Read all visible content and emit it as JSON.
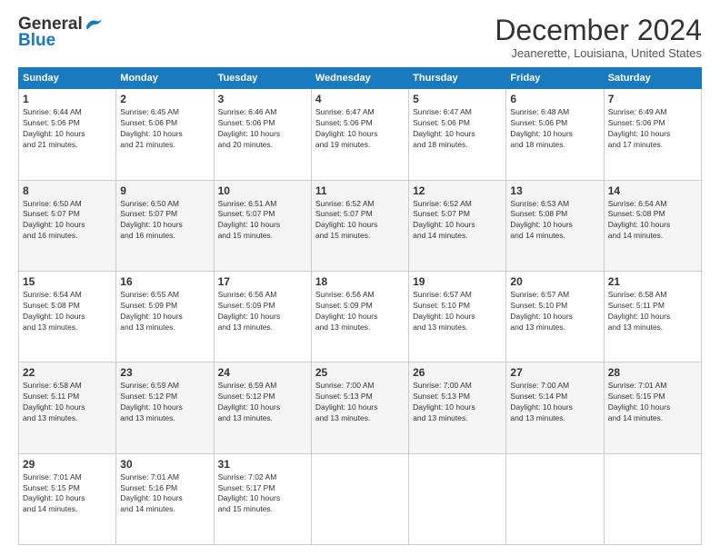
{
  "logo": {
    "general": "General",
    "blue": "Blue"
  },
  "title": "December 2024",
  "location": "Jeanerette, Louisiana, United States",
  "days_of_week": [
    "Sunday",
    "Monday",
    "Tuesday",
    "Wednesday",
    "Thursday",
    "Friday",
    "Saturday"
  ],
  "weeks": [
    [
      {
        "day": "1",
        "sunrise": "6:44 AM",
        "sunset": "5:06 PM",
        "daylight": "10 hours and 21 minutes."
      },
      {
        "day": "2",
        "sunrise": "6:45 AM",
        "sunset": "5:06 PM",
        "daylight": "10 hours and 21 minutes."
      },
      {
        "day": "3",
        "sunrise": "6:46 AM",
        "sunset": "5:06 PM",
        "daylight": "10 hours and 20 minutes."
      },
      {
        "day": "4",
        "sunrise": "6:47 AM",
        "sunset": "5:06 PM",
        "daylight": "10 hours and 19 minutes."
      },
      {
        "day": "5",
        "sunrise": "6:47 AM",
        "sunset": "5:06 PM",
        "daylight": "10 hours and 18 minutes."
      },
      {
        "day": "6",
        "sunrise": "6:48 AM",
        "sunset": "5:06 PM",
        "daylight": "10 hours and 18 minutes."
      },
      {
        "day": "7",
        "sunrise": "6:49 AM",
        "sunset": "5:06 PM",
        "daylight": "10 hours and 17 minutes."
      }
    ],
    [
      {
        "day": "8",
        "sunrise": "6:50 AM",
        "sunset": "5:07 PM",
        "daylight": "10 hours and 16 minutes."
      },
      {
        "day": "9",
        "sunrise": "6:50 AM",
        "sunset": "5:07 PM",
        "daylight": "10 hours and 16 minutes."
      },
      {
        "day": "10",
        "sunrise": "6:51 AM",
        "sunset": "5:07 PM",
        "daylight": "10 hours and 15 minutes."
      },
      {
        "day": "11",
        "sunrise": "6:52 AM",
        "sunset": "5:07 PM",
        "daylight": "10 hours and 15 minutes."
      },
      {
        "day": "12",
        "sunrise": "6:52 AM",
        "sunset": "5:07 PM",
        "daylight": "10 hours and 14 minutes."
      },
      {
        "day": "13",
        "sunrise": "6:53 AM",
        "sunset": "5:08 PM",
        "daylight": "10 hours and 14 minutes."
      },
      {
        "day": "14",
        "sunrise": "6:54 AM",
        "sunset": "5:08 PM",
        "daylight": "10 hours and 14 minutes."
      }
    ],
    [
      {
        "day": "15",
        "sunrise": "6:54 AM",
        "sunset": "5:08 PM",
        "daylight": "10 hours and 13 minutes."
      },
      {
        "day": "16",
        "sunrise": "6:55 AM",
        "sunset": "5:09 PM",
        "daylight": "10 hours and 13 minutes."
      },
      {
        "day": "17",
        "sunrise": "6:56 AM",
        "sunset": "5:09 PM",
        "daylight": "10 hours and 13 minutes."
      },
      {
        "day": "18",
        "sunrise": "6:56 AM",
        "sunset": "5:09 PM",
        "daylight": "10 hours and 13 minutes."
      },
      {
        "day": "19",
        "sunrise": "6:57 AM",
        "sunset": "5:10 PM",
        "daylight": "10 hours and 13 minutes."
      },
      {
        "day": "20",
        "sunrise": "6:57 AM",
        "sunset": "5:10 PM",
        "daylight": "10 hours and 13 minutes."
      },
      {
        "day": "21",
        "sunrise": "6:58 AM",
        "sunset": "5:11 PM",
        "daylight": "10 hours and 13 minutes."
      }
    ],
    [
      {
        "day": "22",
        "sunrise": "6:58 AM",
        "sunset": "5:11 PM",
        "daylight": "10 hours and 13 minutes."
      },
      {
        "day": "23",
        "sunrise": "6:59 AM",
        "sunset": "5:12 PM",
        "daylight": "10 hours and 13 minutes."
      },
      {
        "day": "24",
        "sunrise": "6:59 AM",
        "sunset": "5:12 PM",
        "daylight": "10 hours and 13 minutes."
      },
      {
        "day": "25",
        "sunrise": "7:00 AM",
        "sunset": "5:13 PM",
        "daylight": "10 hours and 13 minutes."
      },
      {
        "day": "26",
        "sunrise": "7:00 AM",
        "sunset": "5:13 PM",
        "daylight": "10 hours and 13 minutes."
      },
      {
        "day": "27",
        "sunrise": "7:00 AM",
        "sunset": "5:14 PM",
        "daylight": "10 hours and 13 minutes."
      },
      {
        "day": "28",
        "sunrise": "7:01 AM",
        "sunset": "5:15 PM",
        "daylight": "10 hours and 14 minutes."
      }
    ],
    [
      {
        "day": "29",
        "sunrise": "7:01 AM",
        "sunset": "5:15 PM",
        "daylight": "10 hours and 14 minutes."
      },
      {
        "day": "30",
        "sunrise": "7:01 AM",
        "sunset": "5:16 PM",
        "daylight": "10 hours and 14 minutes."
      },
      {
        "day": "31",
        "sunrise": "7:02 AM",
        "sunset": "5:17 PM",
        "daylight": "10 hours and 15 minutes."
      },
      null,
      null,
      null,
      null
    ]
  ],
  "labels": {
    "sunrise_prefix": "Sunrise: ",
    "sunset_prefix": "Sunset: ",
    "daylight_prefix": "Daylight: "
  }
}
